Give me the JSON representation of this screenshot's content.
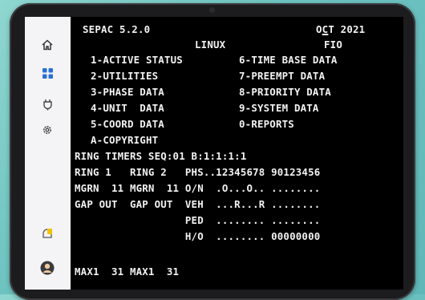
{
  "sidebar": {
    "items": [
      {
        "icon": "home-icon"
      },
      {
        "icon": "apps-grid-icon"
      },
      {
        "icon": "plugin-icon"
      },
      {
        "icon": "gear-icon"
      },
      {
        "icon": "notification-icon"
      },
      {
        "icon": "user-avatar-icon"
      }
    ],
    "accent": "#2b6fd6"
  },
  "terminal": {
    "version": "SEPAC 5.2.0",
    "date": "OCT 2021",
    "os": "LINUX",
    "fio": "FIO",
    "menu_left": [
      "1-ACTIVE STATUS",
      "2-UTILITIES",
      "3-PHASE DATA",
      "4-UNIT  DATA",
      "5-COORD DATA",
      "A-COPYRIGHT"
    ],
    "menu_right": [
      "6-TIME BASE DATA",
      "7-PREEMPT DATA",
      "8-PRIORITY DATA",
      "9-SYSTEM DATA",
      "0-REPORTS"
    ],
    "ring_timers": "RING TIMERS SEQ:01 B:1:1:1:1",
    "row1": "RING 1   RING 2   PHS..12345678 90123456",
    "row2": "MGRN  11 MGRN  11 O/N  .O...O.. ........",
    "row3": "GAP OUT  GAP OUT  VEH  ...R...R ........",
    "row4": "                  PED  ........ ........",
    "row5": "                  H/O  ........ 00000000",
    "bottom": "MAX1  31 MAX1  31"
  }
}
